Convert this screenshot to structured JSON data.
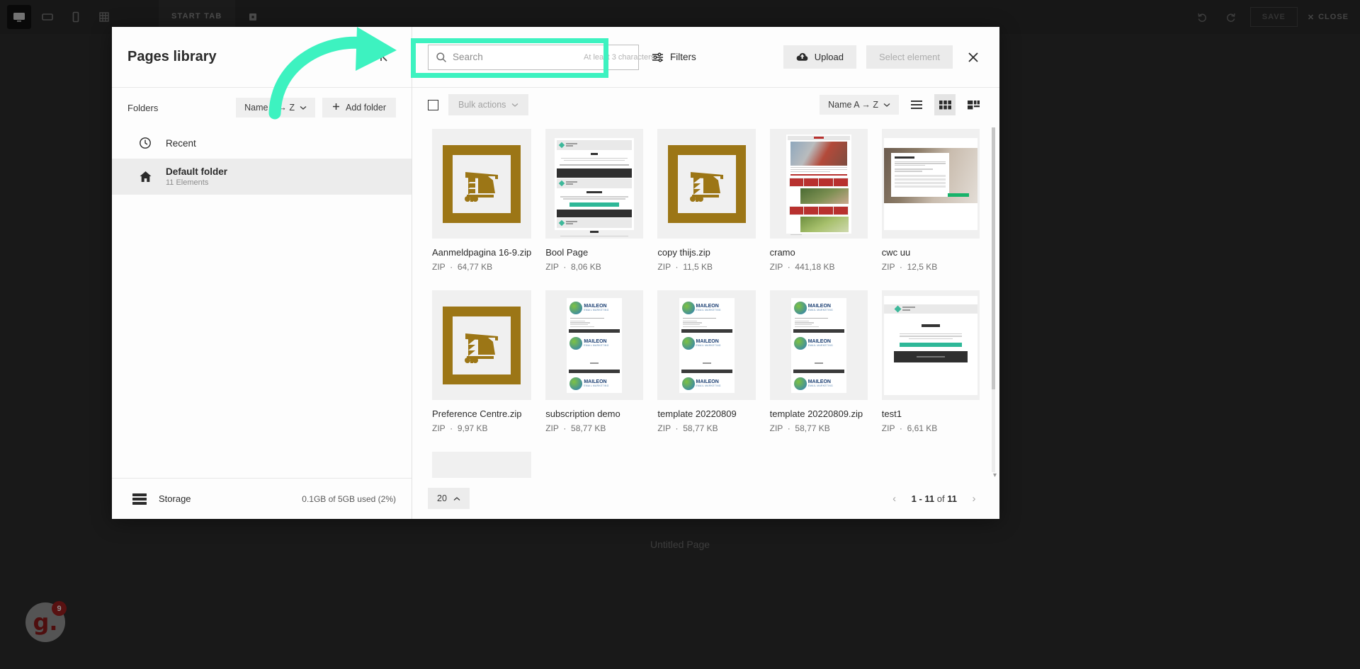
{
  "editor": {
    "device_icons": [
      "desktop-icon",
      "tablet-icon",
      "mobile-icon",
      "grid-icon"
    ],
    "tabs": [
      {
        "label": "START TAB"
      }
    ],
    "add_tab_icon": "add-tab-icon",
    "undo_label": "undo-icon",
    "redo_label": "redo-icon",
    "save_label": "SAVE",
    "close_label": "CLOSE",
    "canvas_label": "Untitled Page",
    "chat": {
      "logo": "g.",
      "badge": "9"
    }
  },
  "modal": {
    "title": "Pages library",
    "collapse_icon": "collapse-panel-icon",
    "close_icon": "close-icon",
    "folders": {
      "label": "Folders",
      "sort_label": "Name A → Z",
      "add_folder_label": "Add folder",
      "items": [
        {
          "name": "Recent",
          "icon": "clock-icon",
          "sub": "",
          "selected": false
        },
        {
          "name": "Default folder",
          "icon": "home-icon",
          "sub": "11 Elements",
          "selected": true
        }
      ]
    },
    "storage": {
      "label": "Storage",
      "icon": "server-icon",
      "value": "0.1GB of 5GB used (2%)"
    },
    "search": {
      "placeholder": "Search",
      "value": "",
      "hint": "At least 3 characters",
      "icon": "search-icon"
    },
    "filters_label": "Filters",
    "upload_label": "Upload",
    "select_element_label": "Select element",
    "toolbar": {
      "bulk_actions_label": "Bulk actions",
      "sort_label": "Name A → Z",
      "views": [
        {
          "name": "list-view",
          "active": false
        },
        {
          "name": "grid-view",
          "active": true
        },
        {
          "name": "mosaic-view",
          "active": false
        }
      ]
    },
    "files": [
      {
        "name": "Aanmeldpagina 16-9.zip",
        "type": "ZIP",
        "size": "64,77 KB",
        "thumb": "zip"
      },
      {
        "name": "Bool Page",
        "type": "ZIP",
        "size": "8,06 KB",
        "thumb": "page-dark"
      },
      {
        "name": "copy thijs.zip",
        "type": "ZIP",
        "size": "11,5 KB",
        "thumb": "zip"
      },
      {
        "name": "cramo",
        "type": "ZIP",
        "size": "441,18 KB",
        "thumb": "cramo"
      },
      {
        "name": "cwc uu",
        "type": "ZIP",
        "size": "12,5 KB",
        "thumb": "cwc"
      },
      {
        "name": "Preference Centre.zip",
        "type": "ZIP",
        "size": "9,97 KB",
        "thumb": "zip"
      },
      {
        "name": "subscription demo",
        "type": "ZIP",
        "size": "58,77 KB",
        "thumb": "maileon"
      },
      {
        "name": "template 20220809",
        "type": "ZIP",
        "size": "58,77 KB",
        "thumb": "maileon"
      },
      {
        "name": "template 20220809.zip",
        "type": "ZIP",
        "size": "58,77 KB",
        "thumb": "maileon"
      },
      {
        "name": "test1",
        "type": "ZIP",
        "size": "6,61 KB",
        "thumb": "thankyou"
      },
      {
        "name": "",
        "type": "",
        "size": "",
        "thumb": "blank"
      }
    ],
    "pagination": {
      "per_page": "20",
      "range": "1 - 11",
      "of_label": "of",
      "total": "11",
      "prev_icon": "chevron-left-icon",
      "next_icon": "chevron-right-icon"
    }
  },
  "annotation": {
    "highlight_color": "#3df2c0",
    "target": "search-input"
  }
}
